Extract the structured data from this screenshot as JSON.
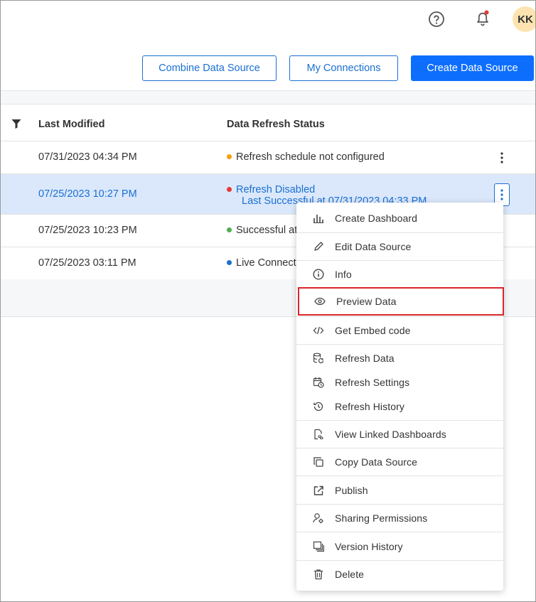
{
  "header": {
    "avatar_initials": "KK",
    "icons": [
      "help-icon",
      "bell-icon"
    ],
    "notification_dot_color": "#e53935"
  },
  "toolbar": {
    "combine_label": "Combine Data Source",
    "connections_label": "My Connections",
    "create_label": "Create Data Source"
  },
  "table": {
    "columns": [
      "Last Modified",
      "Data Refresh Status"
    ],
    "rows": [
      {
        "date": "07/31/2023 04:34 PM",
        "status": "Refresh schedule not configured",
        "status_color": "#f59e0b"
      },
      {
        "date": "07/25/2023 10:27 PM",
        "status": "Refresh Disabled",
        "status_sub": "Last Successful at 07/31/2023 04:33 PM",
        "status_color": "#e53935"
      },
      {
        "date": "07/25/2023 10:23 PM",
        "status": "Successful at",
        "status_color": "#4caf50"
      },
      {
        "date": "07/25/2023 03:11 PM",
        "status": "Live Connect",
        "status_color": "#1a6fd3"
      }
    ]
  },
  "context_menu": {
    "items": [
      {
        "label": "Create Dashboard",
        "icon": "bar-chart-icon"
      },
      {
        "label": "Edit Data Source",
        "icon": "pencil-icon"
      },
      {
        "label": "Info",
        "icon": "info-icon"
      },
      {
        "label": "Preview Data",
        "icon": "eye-icon"
      },
      {
        "label": "Get Embed code",
        "icon": "code-icon"
      },
      {
        "label": "Refresh Data",
        "icon": "database-refresh-icon"
      },
      {
        "label": "Refresh Settings",
        "icon": "calendar-clock-icon"
      },
      {
        "label": "Refresh History",
        "icon": "history-icon"
      },
      {
        "label": "View Linked Dashboards",
        "icon": "linked-file-icon"
      },
      {
        "label": "Copy Data Source",
        "icon": "copy-icon"
      },
      {
        "label": "Publish",
        "icon": "publish-icon"
      },
      {
        "label": "Sharing Permissions",
        "icon": "user-settings-icon"
      },
      {
        "label": "Version History",
        "icon": "versions-icon"
      },
      {
        "label": "Delete",
        "icon": "trash-icon"
      }
    ]
  }
}
